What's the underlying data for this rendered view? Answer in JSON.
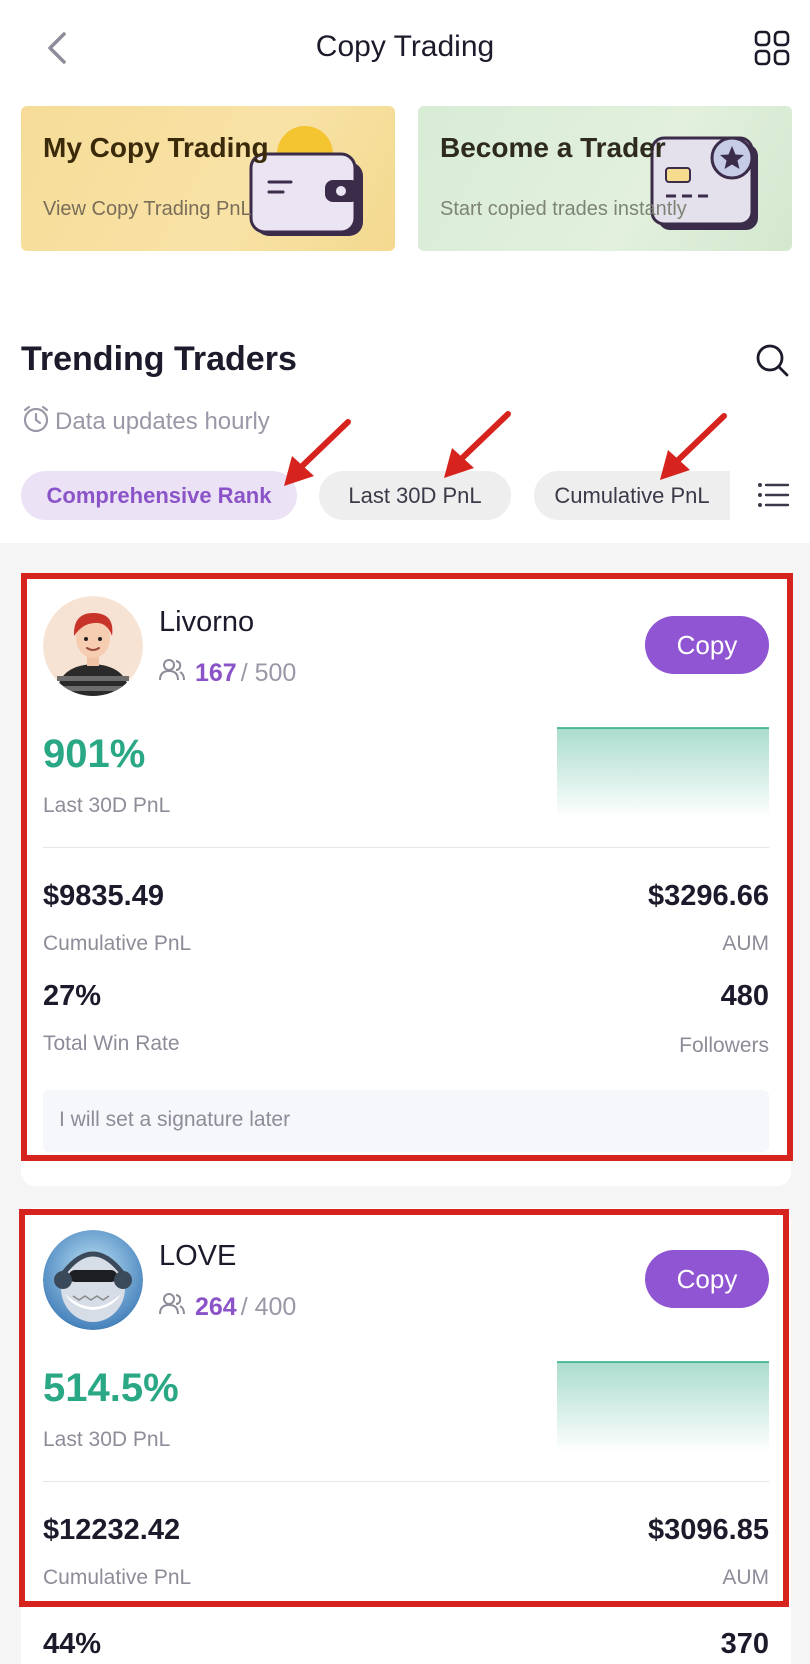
{
  "header": {
    "title": "Copy Trading"
  },
  "promos": [
    {
      "title": "My Copy Trading",
      "subtitle": "View Copy Trading PnL"
    },
    {
      "title": "Become a Trader",
      "subtitle": "Start copied trades instantly"
    }
  ],
  "section": {
    "title": "Trending Traders",
    "update_note": "Data updates hourly"
  },
  "filters": [
    "Comprehensive Rank",
    "Last 30D PnL",
    "Cumulative PnL"
  ],
  "active_filter": "Comprehensive Rank",
  "traders": [
    {
      "name": "Livorno",
      "followers_count": "167",
      "followers_max": "/ 500",
      "copy_label": "Copy",
      "pnl_30d": "901%",
      "pnl_30d_label": "Last 30D PnL",
      "cumulative_pnl": "$9835.49",
      "cumulative_pnl_label": "Cumulative PnL",
      "aum": "$3296.66",
      "aum_label": "AUM",
      "win_rate": "27%",
      "win_rate_label": "Total Win Rate",
      "followers": "480",
      "followers_label": "Followers",
      "signature": "I will set a signature later"
    },
    {
      "name": "LOVE",
      "followers_count": "264",
      "followers_max": "/ 400",
      "copy_label": "Copy",
      "pnl_30d": "514.5%",
      "pnl_30d_label": "Last 30D PnL",
      "cumulative_pnl": "$12232.42",
      "cumulative_pnl_label": "Cumulative PnL",
      "aum": "$3096.85",
      "aum_label": "AUM",
      "win_rate": "44%",
      "followers": "370"
    }
  ],
  "colors": {
    "accent": "#9055d2",
    "positive": "#2aa784",
    "annotation": "#d6231e"
  }
}
